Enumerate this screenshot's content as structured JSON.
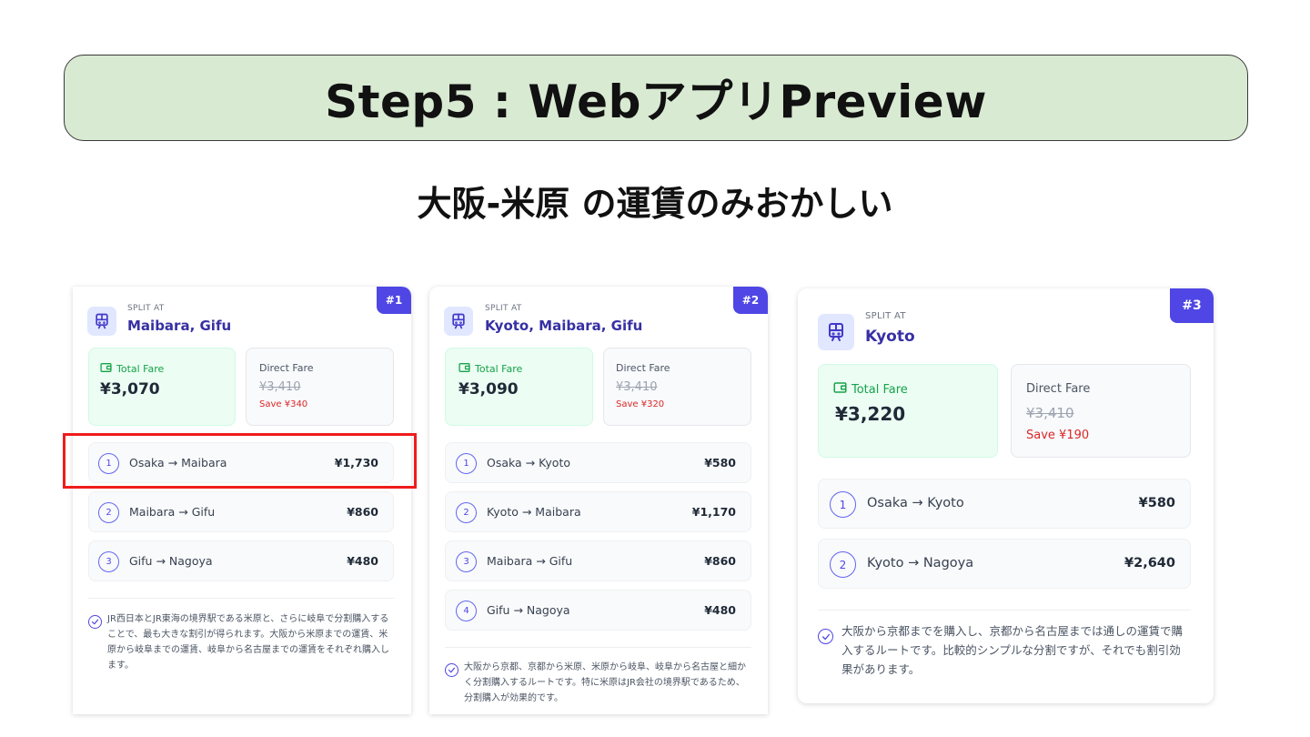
{
  "header": {
    "title": "Step5 : WebアプリPreview",
    "subtitle": "大阪-米原 の運賃のみおかしい"
  },
  "colors": {
    "accent": "#4f46e5",
    "banner_bg": "#d9ead3",
    "highlight": "#ef1c1c",
    "save_red": "#dc2626",
    "fare_green": "#16a34a"
  },
  "cards": [
    {
      "rank": "#1",
      "split_label": "SPLIT AT",
      "split_value": "Maibara, Gifu",
      "total_fare_label": "Total Fare",
      "total_fare": "¥3,070",
      "direct_fare_label": "Direct Fare",
      "direct_fare": "¥3,410",
      "save": "Save ¥340",
      "legs": [
        {
          "num": "1",
          "route": "Osaka → Maibara",
          "price": "¥1,730"
        },
        {
          "num": "2",
          "route": "Maibara → Gifu",
          "price": "¥860"
        },
        {
          "num": "3",
          "route": "Gifu → Nagoya",
          "price": "¥480"
        }
      ],
      "note": "JR西日本とJR東海の境界駅である米原と、さらに岐阜で分割購入することで、最も大きな割引が得られます。大阪から米原までの運賃、米原から岐阜までの運賃、岐阜から名古屋までの運賃をそれぞれ購入します。"
    },
    {
      "rank": "#2",
      "split_label": "SPLIT AT",
      "split_value": "Kyoto, Maibara, Gifu",
      "total_fare_label": "Total Fare",
      "total_fare": "¥3,090",
      "direct_fare_label": "Direct Fare",
      "direct_fare": "¥3,410",
      "save": "Save ¥320",
      "legs": [
        {
          "num": "1",
          "route": "Osaka → Kyoto",
          "price": "¥580"
        },
        {
          "num": "2",
          "route": "Kyoto → Maibara",
          "price": "¥1,170"
        },
        {
          "num": "3",
          "route": "Maibara → Gifu",
          "price": "¥860"
        },
        {
          "num": "4",
          "route": "Gifu → Nagoya",
          "price": "¥480"
        }
      ],
      "note": "大阪から京都、京都から米原、米原から岐阜、岐阜から名古屋と細かく分割購入するルートです。特に米原はJR会社の境界駅であるため、分割購入が効果的です。"
    },
    {
      "rank": "#3",
      "split_label": "SPLIT AT",
      "split_value": "Kyoto",
      "total_fare_label": "Total Fare",
      "total_fare": "¥3,220",
      "direct_fare_label": "Direct Fare",
      "direct_fare": "¥3,410",
      "save": "Save ¥190",
      "legs": [
        {
          "num": "1",
          "route": "Osaka → Kyoto",
          "price": "¥580"
        },
        {
          "num": "2",
          "route": "Kyoto → Nagoya",
          "price": "¥2,640"
        }
      ],
      "note": "大阪から京都までを購入し、京都から名古屋までは通しの運賃で購入するルートです。比較的シンプルな分割ですが、それでも割引効果があります。"
    }
  ]
}
